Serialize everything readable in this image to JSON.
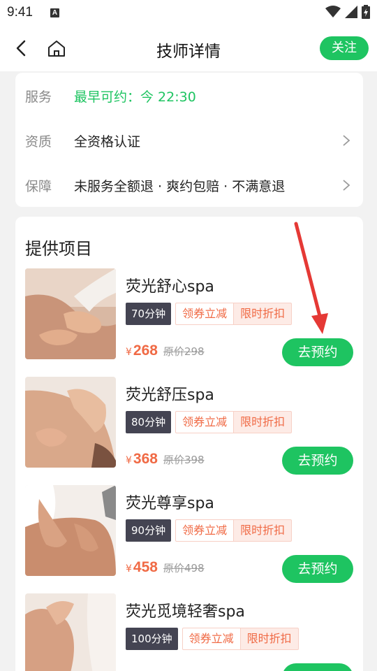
{
  "status_bar": {
    "time": "9:41",
    "notification_letter": "A"
  },
  "header": {
    "title": "技师详情",
    "follow_label": "关注"
  },
  "info": {
    "rows": [
      {
        "label": "服务",
        "value": "最早可约：今 22:30",
        "accent": "#1ec461"
      },
      {
        "label": "资质",
        "value": "全资格认证"
      },
      {
        "label": "保障",
        "value": "未服务全额退 · 爽约包赔 · 不满意退"
      }
    ]
  },
  "projects": {
    "title": "提供项目",
    "items": [
      {
        "name": "荧光舒心spa",
        "duration": "70分钟",
        "coupon_tag": "领券立减",
        "discount_tag": "限时折扣",
        "currency": "¥",
        "price": "268",
        "original": "原价298",
        "book_label": "去预约"
      },
      {
        "name": "荧光舒压spa",
        "duration": "80分钟",
        "coupon_tag": "领券立减",
        "discount_tag": "限时折扣",
        "currency": "¥",
        "price": "368",
        "original": "原价398",
        "book_label": "去预约"
      },
      {
        "name": "荧光尊享spa",
        "duration": "90分钟",
        "coupon_tag": "领券立减",
        "discount_tag": "限时折扣",
        "currency": "¥",
        "price": "458",
        "original": "原价498",
        "book_label": "去预约"
      },
      {
        "name": "荧光觅境轻奢spa",
        "duration": "100分钟",
        "coupon_tag": "领券立减",
        "discount_tag": "限时折扣",
        "currency": "¥",
        "price": "",
        "original": "",
        "book_label": ""
      }
    ]
  },
  "colors": {
    "brand_green": "#1ec461",
    "price_orange": "#f06a45",
    "annotation_arrow": "#e53935"
  }
}
